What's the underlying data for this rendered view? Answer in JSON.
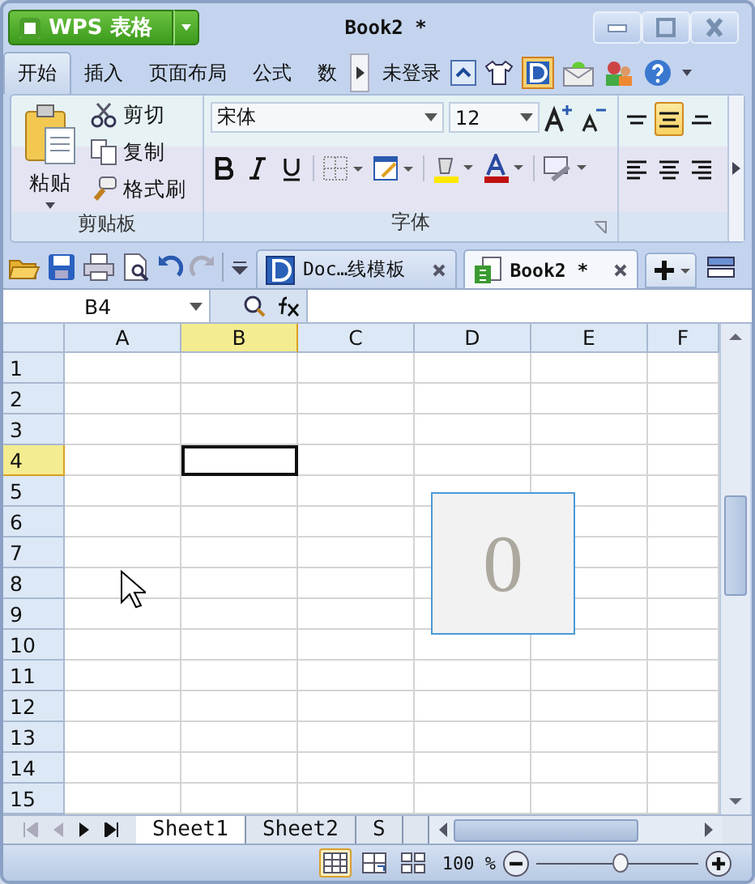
{
  "title_bar": {
    "app_button": "WPS 表格",
    "title": "Book2 *"
  },
  "ribbon_tabs": [
    {
      "label": "开始",
      "selected": true
    },
    {
      "label": "插入",
      "selected": false
    },
    {
      "label": "页面布局",
      "selected": false
    },
    {
      "label": "公式",
      "selected": false
    },
    {
      "label": "数",
      "selected": false
    }
  ],
  "account": "未登录",
  "clipboard": {
    "paste": "粘贴",
    "cut": "剪切",
    "copy": "复制",
    "format_painter": "格式刷",
    "group_label": "剪贴板"
  },
  "font": {
    "name": "宋体",
    "size": "12",
    "group_label": "字体"
  },
  "vertical_align": [
    {
      "selected": false
    },
    {
      "selected": true
    },
    {
      "selected": false
    }
  ],
  "doc_tabs": [
    {
      "label": "Doc…线模板",
      "selected": false,
      "kind": "writer"
    },
    {
      "label": "Book2 *",
      "selected": true,
      "kind": "sheet"
    }
  ],
  "formula_bar": {
    "cell_ref": "B4"
  },
  "sheet": {
    "columns": [
      {
        "label": "A",
        "selected": false
      },
      {
        "label": "B",
        "selected": true
      },
      {
        "label": "C",
        "selected": false
      },
      {
        "label": "D",
        "selected": false
      },
      {
        "label": "E",
        "selected": false
      },
      {
        "label": "F",
        "selected": false
      }
    ],
    "rows": [
      {
        "label": "1",
        "selected": false
      },
      {
        "label": "2",
        "selected": false
      },
      {
        "label": "3",
        "selected": false
      },
      {
        "label": "4",
        "selected": true
      },
      {
        "label": "5",
        "selected": false
      },
      {
        "label": "6",
        "selected": false
      },
      {
        "label": "7",
        "selected": false
      },
      {
        "label": "8",
        "selected": false
      },
      {
        "label": "9",
        "selected": false
      },
      {
        "label": "10",
        "selected": false
      },
      {
        "label": "11",
        "selected": false
      },
      {
        "label": "12",
        "selected": false
      },
      {
        "label": "13",
        "selected": false
      },
      {
        "label": "14",
        "selected": false
      },
      {
        "label": "15",
        "selected": false
      }
    ],
    "overlay_value": "0"
  },
  "sheet_tabs": [
    {
      "label": "Sheet1",
      "selected": true
    },
    {
      "label": "Sheet2",
      "selected": false
    },
    {
      "label": "S",
      "selected": false
    }
  ],
  "status_bar": {
    "view_modes": [
      {
        "selected": true
      },
      {
        "selected": false
      },
      {
        "selected": false
      }
    ],
    "zoom": "100 %",
    "zoom_slider": {
      "level": 0.52
    }
  }
}
